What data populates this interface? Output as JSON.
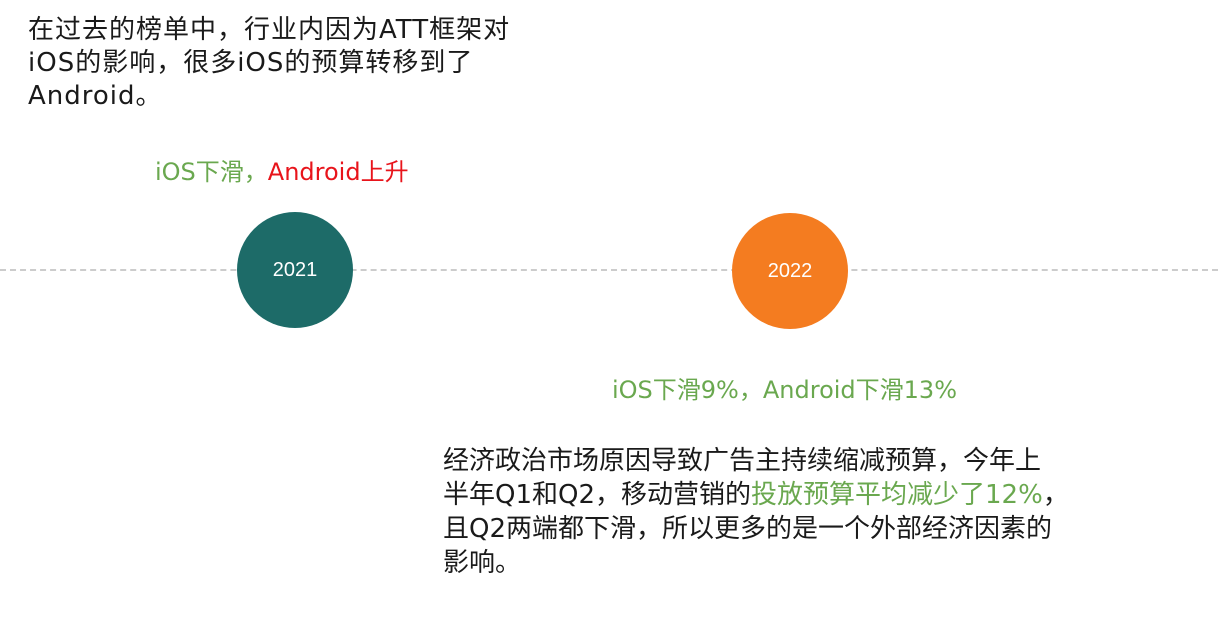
{
  "intro": {
    "line1": "在过去的榜单中，行业内因为ATT框架对",
    "line2": "iOS的影响，很多iOS的预算转移到了",
    "line3": "Android。"
  },
  "event_2021": {
    "year": "2021",
    "label_ios": "iOS下滑，",
    "label_android": "Android上升",
    "color": "#1d6b68"
  },
  "event_2022": {
    "year": "2022",
    "label": "iOS下滑9%，Android下滑13%",
    "color": "#f47c20"
  },
  "description": {
    "line1": "经济政治市场原因导致广告主持续缩减预算，今年上",
    "line2_a": "半年Q1和Q2，移动营销的",
    "line2_highlight": "投放预算平均减少了12%",
    "line2_b": "，",
    "line3": "且Q2两端都下滑，所以更多的是一个外部经济因素的",
    "line4": "影响。"
  },
  "colors": {
    "green_text": "#6aa84f",
    "red_text": "#e8141b"
  }
}
